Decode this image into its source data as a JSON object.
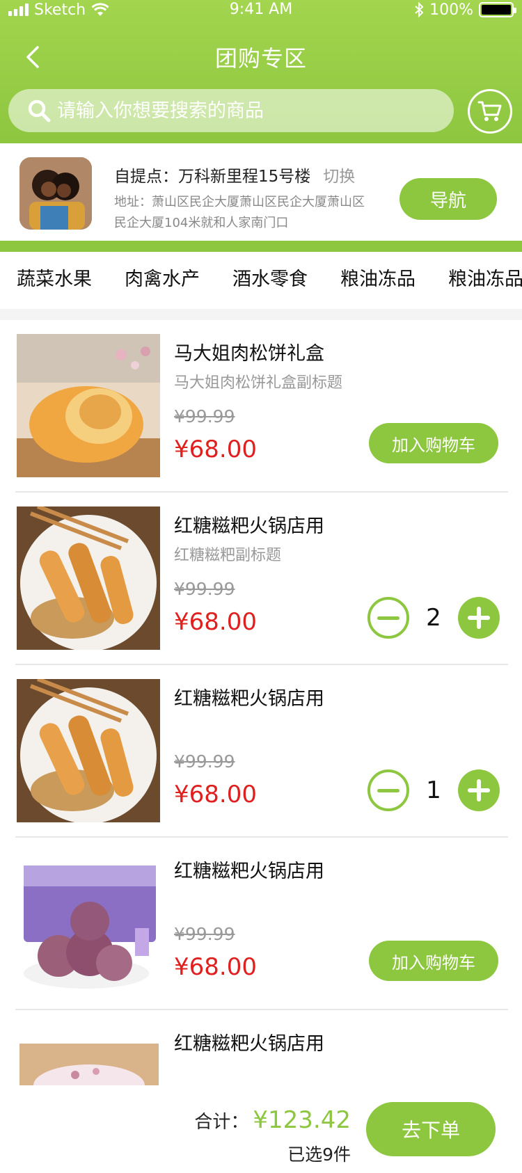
{
  "status_bar": {
    "carrier": "Sketch",
    "time": "9:41 AM",
    "battery": "100%"
  },
  "header": {
    "title": "团购专区"
  },
  "search": {
    "placeholder": "请输入你想要搜索的商品"
  },
  "pickup": {
    "name_label": "自提点：万科新里程15号楼",
    "switch_label": "切换",
    "address": "地址：萧山区民企大厦萧山区民企大厦萧山区民企大厦104米就和人家南门口",
    "nav_label": "导航"
  },
  "categories": [
    "蔬菜水果",
    "肉禽水产",
    "酒水零食",
    "粮油冻品",
    "粮油冻品"
  ],
  "products": [
    {
      "name": "马大姐肉松饼礼盒",
      "subtitle": "马大姐肉松饼礼盒副标题",
      "old_price": "¥99.99",
      "price": "¥68.00",
      "action": "加入购物车"
    },
    {
      "name": "红糖糍粑火锅店用",
      "subtitle": "红糖糍粑副标题",
      "old_price": "¥99.99",
      "price": "¥68.00",
      "quantity": "2"
    },
    {
      "name": "红糖糍粑火锅店用",
      "subtitle": "",
      "old_price": "¥99.99",
      "price": "¥68.00",
      "quantity": "1"
    },
    {
      "name": "红糖糍粑火锅店用",
      "subtitle": "",
      "old_price": "¥99.99",
      "price": "¥68.00",
      "action": "加入购物车"
    },
    {
      "name": "红糖糍粑火锅店用"
    }
  ],
  "footer": {
    "total_label": "合计：",
    "total_value": "¥123.42",
    "selected": "已选9件",
    "checkout": "去下单"
  },
  "colors": {
    "brand_green": "#8dc63f",
    "price_red": "#e0201f"
  }
}
